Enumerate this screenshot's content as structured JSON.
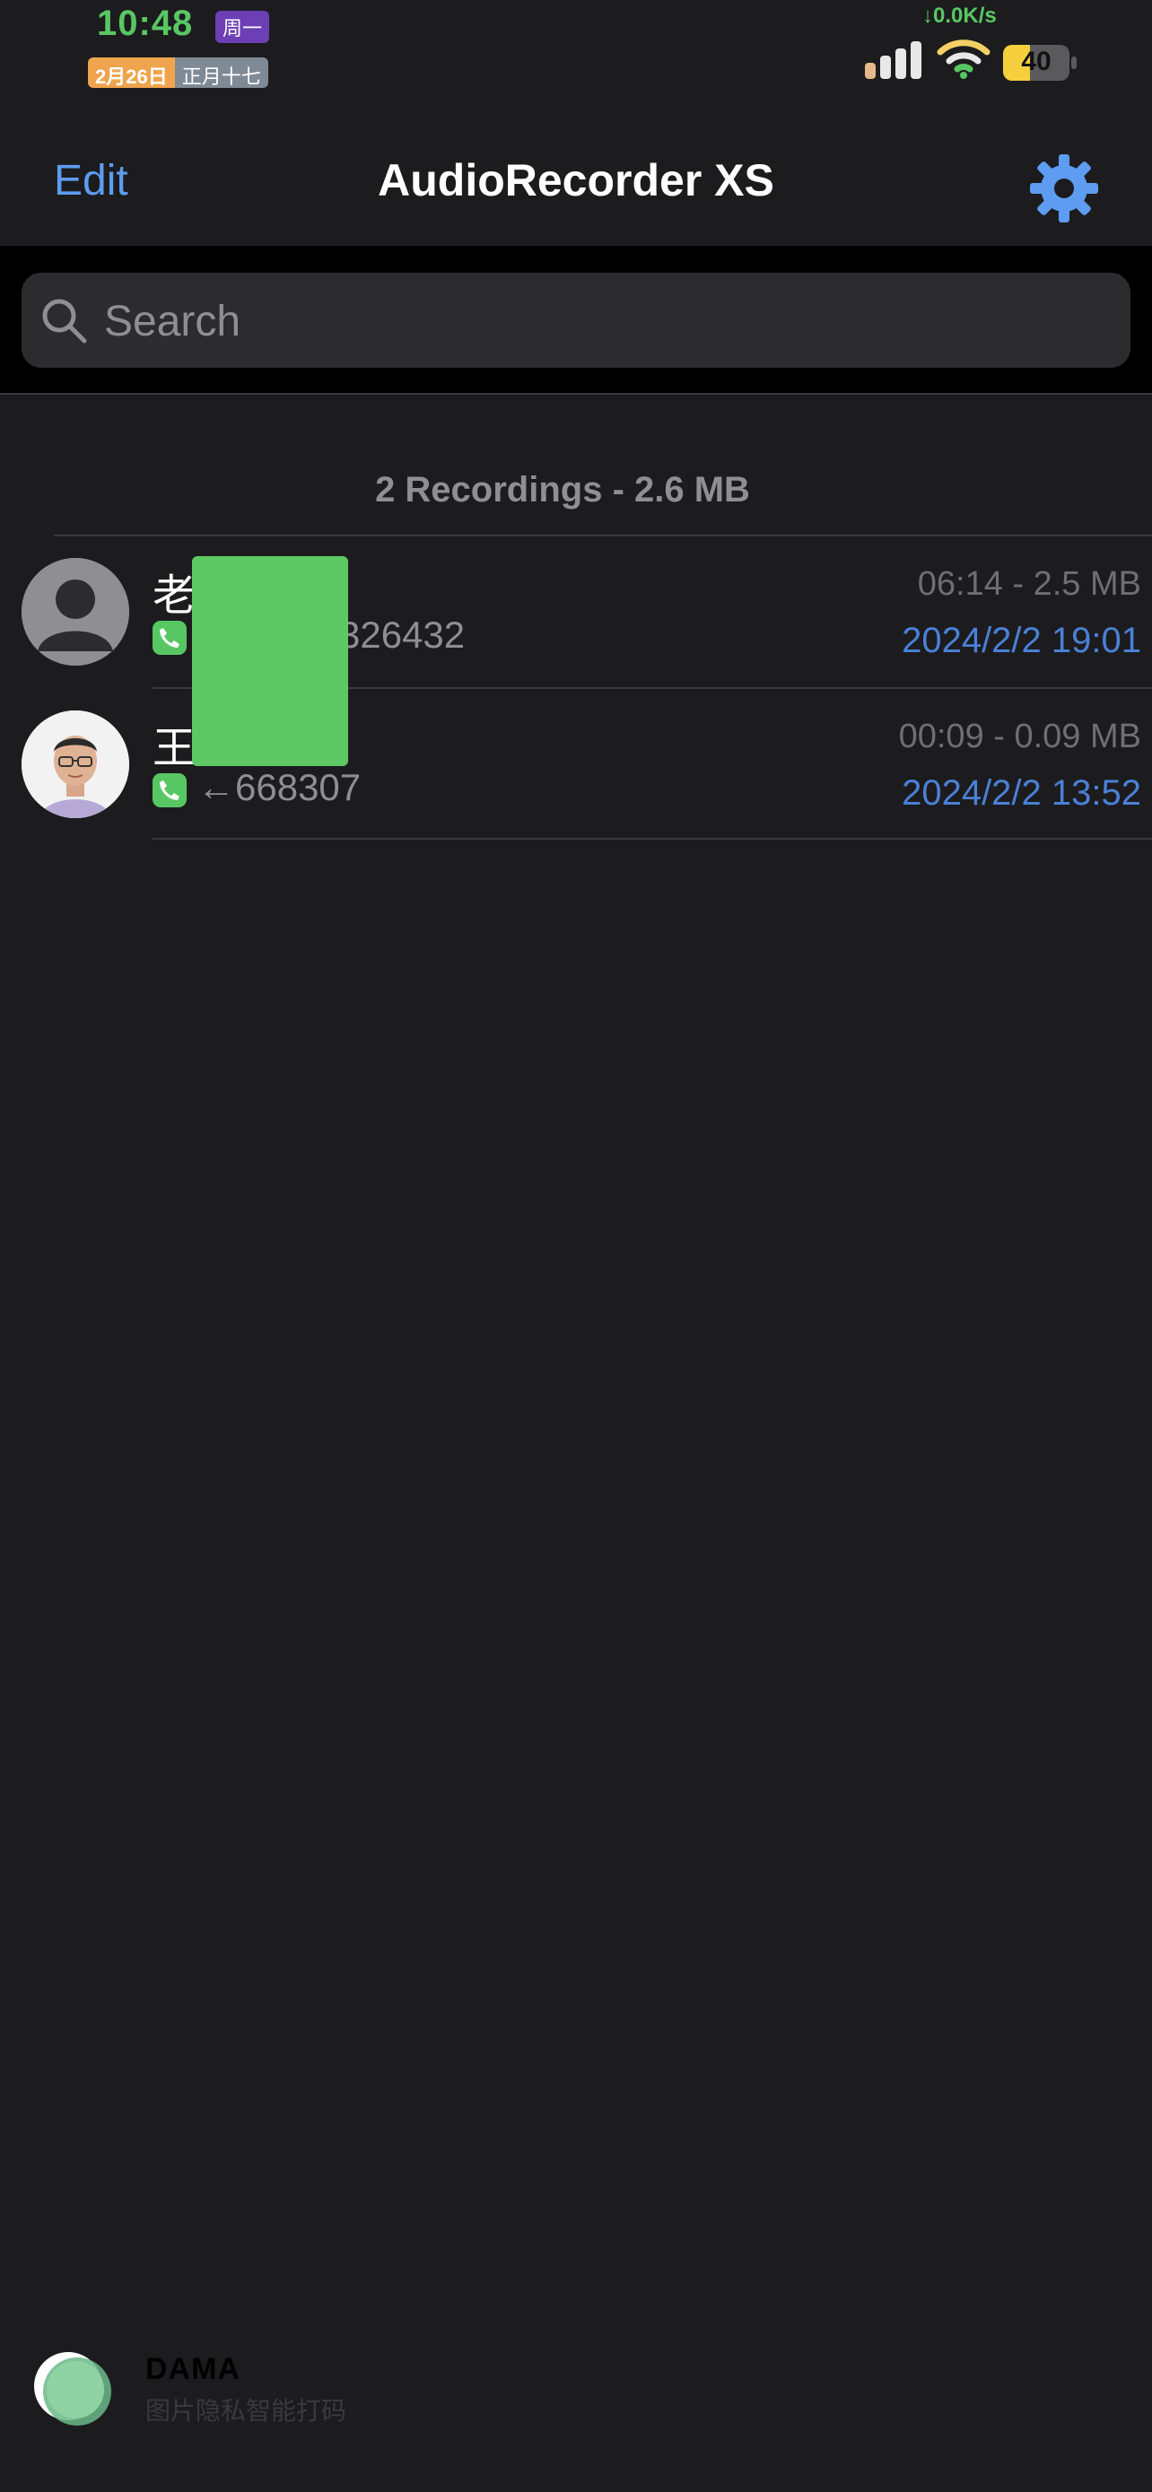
{
  "status_bar": {
    "time": "10:48",
    "weekday": "周一",
    "date_solar": "2月26日",
    "date_lunar": "正月十七",
    "net_speed": "↓0.0K/s",
    "battery_percent": 40,
    "battery_label": "40",
    "colors": {
      "time": "#58c763",
      "weekday_bg": "#6c3fb5",
      "battery": "#f6cf3e"
    }
  },
  "nav": {
    "edit_label": "Edit",
    "title": "AudioRecorder XS",
    "settings_icon": "gear-icon",
    "accent": "#5d9cf0"
  },
  "search": {
    "placeholder": "Search",
    "value": "",
    "icon": "search-icon"
  },
  "summary": "2 Recordings - 2.6 MB",
  "recordings": [
    {
      "name": "老",
      "number": "326432",
      "direction_icon": "phone-icon",
      "duration_size": "06:14 - 2.5 MB",
      "datetime": "2024/2/2 19:01",
      "avatar": "default-person-avatar"
    },
    {
      "name": "王",
      "number": "←668307",
      "direction_icon": "phone-icon",
      "duration_size": "00:09 - 0.09 MB",
      "datetime": "2024/2/2 13:52",
      "avatar": "photo-avatar"
    }
  ],
  "watermark": {
    "title": "DAMA",
    "subtitle": "图片隐私智能打码"
  }
}
